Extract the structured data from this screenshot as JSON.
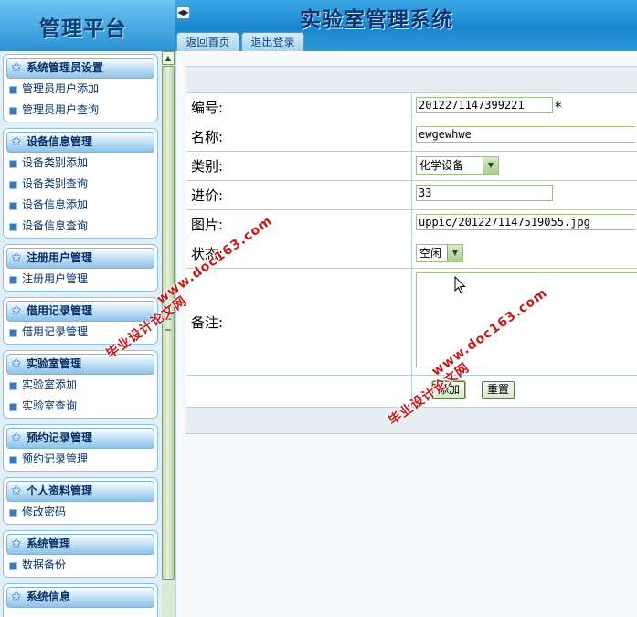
{
  "header": {
    "logo_text": "管理平台",
    "system_title": "实验室管理系统",
    "collapse_symbol": "◀▶",
    "tabs": [
      {
        "label": "返回首页"
      },
      {
        "label": "退出登录"
      }
    ]
  },
  "sidebar": {
    "groups": [
      {
        "title": "系统管理员设置",
        "items": [
          {
            "label": "管理员用户添加"
          },
          {
            "label": "管理员用户查询"
          }
        ]
      },
      {
        "title": "设备信息管理",
        "items": [
          {
            "label": "设备类别添加"
          },
          {
            "label": "设备类别查询"
          },
          {
            "label": "设备信息添加"
          },
          {
            "label": "设备信息查询"
          }
        ]
      },
      {
        "title": "注册用户管理",
        "items": [
          {
            "label": "注册用户管理"
          }
        ]
      },
      {
        "title": "借用记录管理",
        "items": [
          {
            "label": "借用记录管理"
          }
        ]
      },
      {
        "title": "实验室管理",
        "items": [
          {
            "label": "实验室添加"
          },
          {
            "label": "实验室查询"
          }
        ]
      },
      {
        "title": "预约记录管理",
        "items": [
          {
            "label": "预约记录管理"
          }
        ]
      },
      {
        "title": "个人资料管理",
        "items": [
          {
            "label": "修改密码"
          }
        ]
      },
      {
        "title": "系统管理",
        "items": [
          {
            "label": "数据备份"
          }
        ]
      },
      {
        "title": "系统信息",
        "items": []
      }
    ]
  },
  "form": {
    "fields": {
      "id": {
        "label": "编号:",
        "value": "2012271147399221",
        "required_mark": "*"
      },
      "name": {
        "label": "名称:",
        "value": "ewgewhwe"
      },
      "category": {
        "label": "类别:",
        "value": "化学设备"
      },
      "price": {
        "label": "进价:",
        "value": "33"
      },
      "image": {
        "label": "图片:",
        "value": "uppic/2012271147519055.jpg"
      },
      "status": {
        "label": "状态:",
        "value": "空闲"
      },
      "notes": {
        "label": "备注:",
        "value": ""
      }
    },
    "buttons": {
      "add": "添加",
      "reset": "重置"
    }
  },
  "watermarks": {
    "line1": "毕业设计论文网",
    "line2": "www.doc163.com"
  },
  "colors": {
    "header_blue": "#1b86cf",
    "sidebar_bg": "#e1eff9",
    "watermark_red": "#c21a1a"
  },
  "icons": {
    "menu_head": "star-icon",
    "menu_item": "square-bullet-icon",
    "cursor": "mouse-pointer-icon"
  }
}
